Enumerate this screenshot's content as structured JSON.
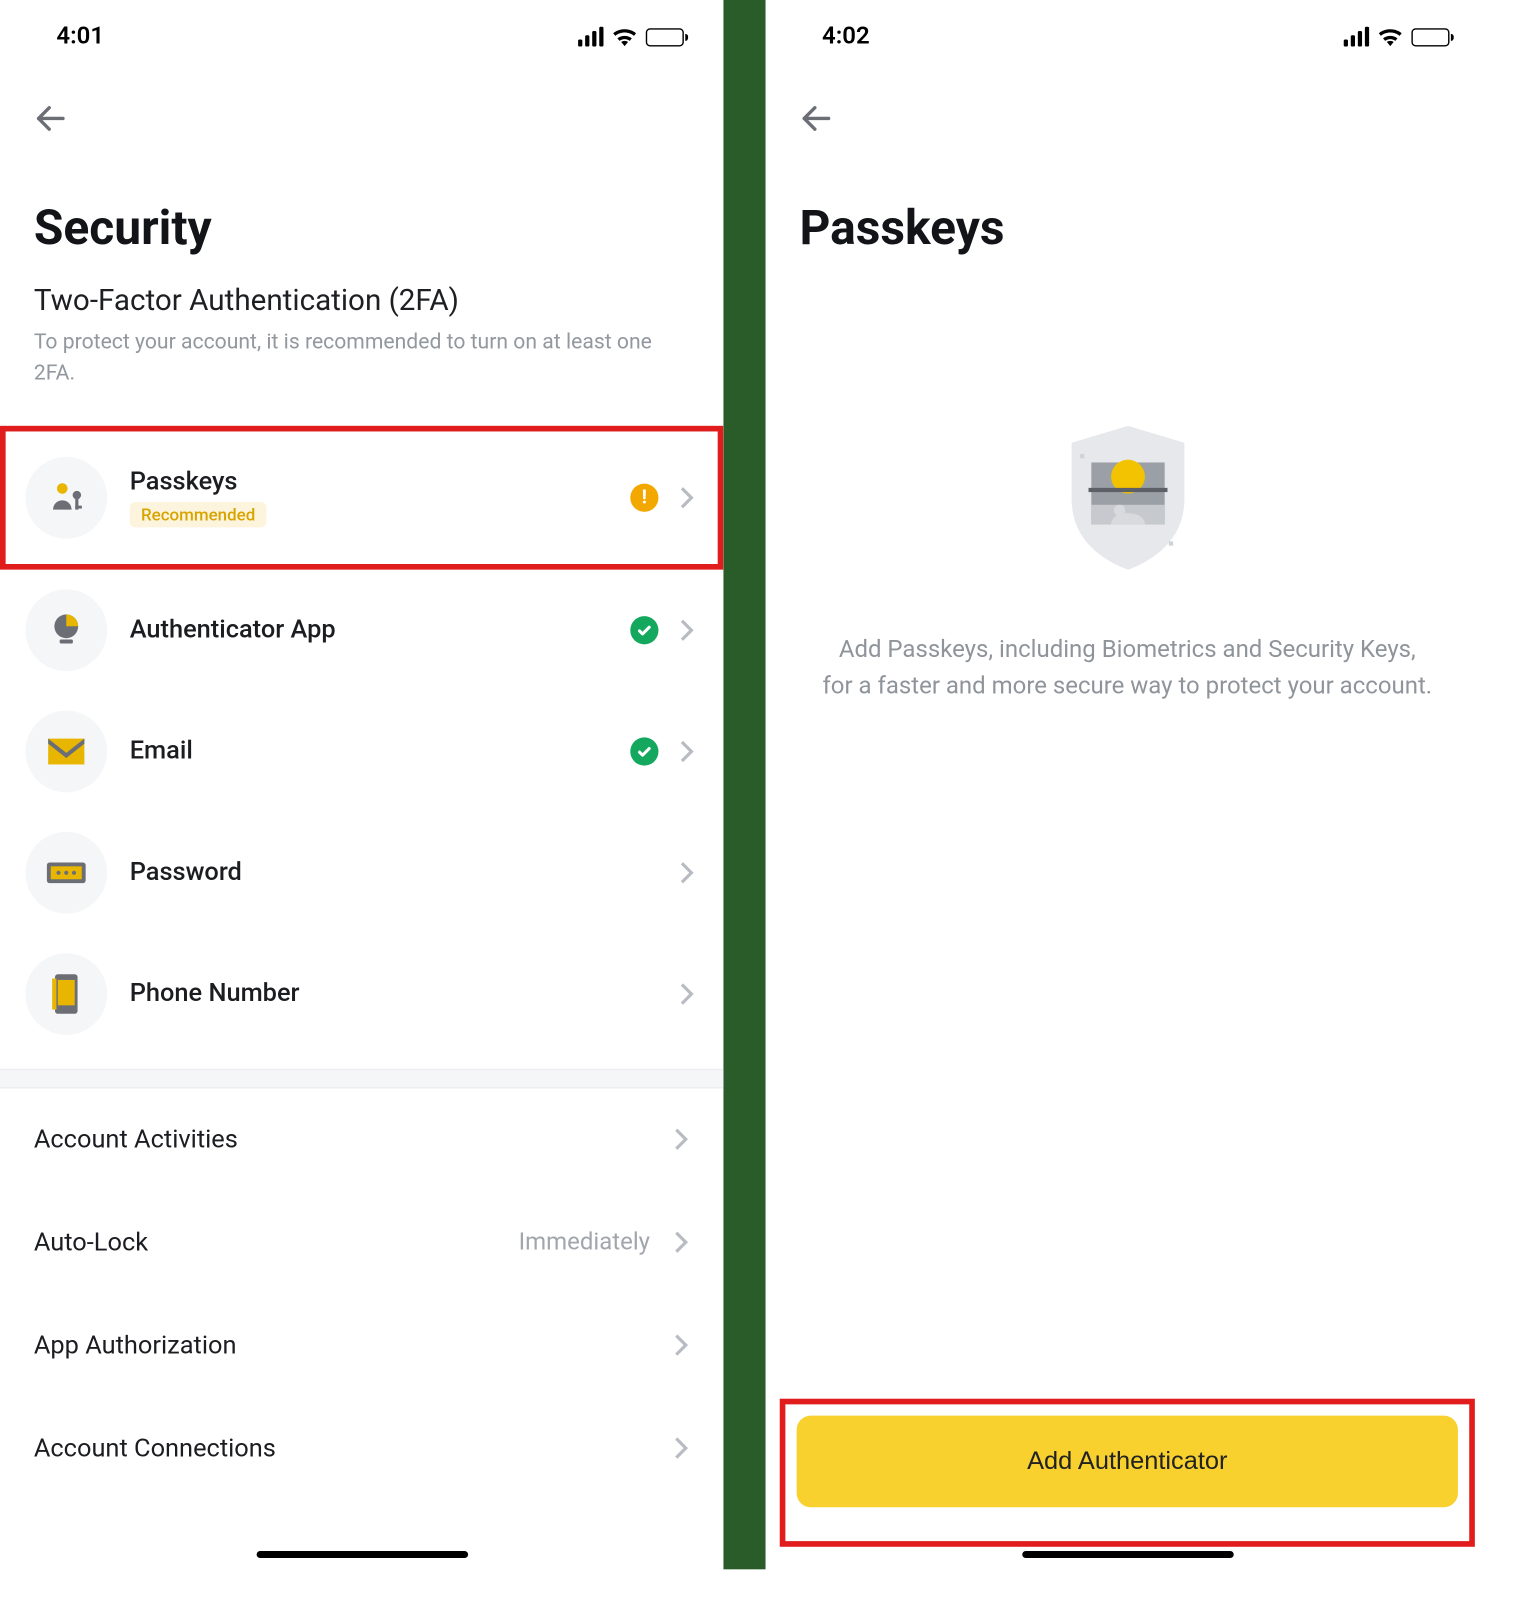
{
  "left": {
    "statusTime": "4:01",
    "title": "Security",
    "twofa": {
      "title": "Two-Factor Authentication (2FA)",
      "subtitle": "To protect your account, it is recommended to turn on at least one 2FA."
    },
    "items": [
      {
        "label": "Passkeys",
        "badge": "Recommended",
        "status": "warn"
      },
      {
        "label": "Authenticator App",
        "status": "ok"
      },
      {
        "label": "Email",
        "status": "ok"
      },
      {
        "label": "Password",
        "status": "none"
      },
      {
        "label": "Phone Number",
        "status": "none"
      }
    ],
    "extra": [
      {
        "label": "Account Activities"
      },
      {
        "label": "Auto-Lock",
        "value": "Immediately"
      },
      {
        "label": "App Authorization"
      },
      {
        "label": "Account Connections"
      }
    ]
  },
  "right": {
    "statusTime": "4:02",
    "title": "Passkeys",
    "emptyText": "Add Passkeys, including Biometrics and Security Keys, for a faster and more secure way to protect your account.",
    "cta": "Add Authenticator"
  }
}
